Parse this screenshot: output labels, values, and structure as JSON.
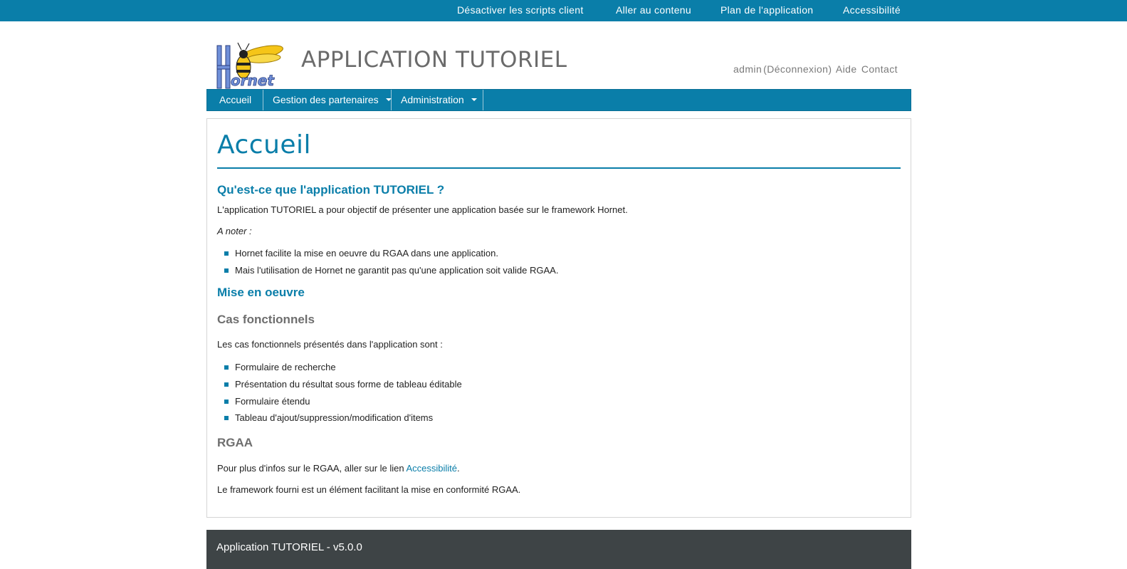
{
  "top_links": [
    "Désactiver les scripts client",
    "Aller au contenu",
    "Plan de l'application",
    "Accessibilité"
  ],
  "header": {
    "logo_text": "Hornet",
    "app_title": "APPLICATION TUTORIEL",
    "user": "admin",
    "logout": "(Déconnexion)",
    "help": "Aide",
    "contact": "Contact"
  },
  "nav": {
    "items": [
      {
        "label": "Accueil"
      },
      {
        "label": "Gestion des partenaires"
      },
      {
        "label": "Administration"
      }
    ]
  },
  "main": {
    "title": "Accueil",
    "section1": {
      "heading": "Qu'est-ce que l'application TUTORIEL ?",
      "intro": "L'application TUTORIEL a pour objectif de présenter une application basée sur le framework Hornet.",
      "note": "A noter :",
      "bullets": [
        "Hornet facilite la mise en oeuvre du RGAA dans une application.",
        "Mais l'utilisation de Hornet ne garantit pas qu'une application soit valide RGAA."
      ]
    },
    "section2": {
      "heading": "Mise en oeuvre",
      "sub1": {
        "heading": "Cas fonctionnels",
        "intro": "Les cas fonctionnels présentés dans l'application sont :",
        "bullets": [
          "Formulaire de recherche",
          "Présentation du résultat sous forme de tableau éditable",
          "Formulaire étendu",
          "Tableau d'ajout/suppression/modification d'items"
        ]
      },
      "sub2": {
        "heading": "RGAA",
        "p1_before": "Pour plus d'infos sur le RGAA, aller sur le lien ",
        "p1_link": "Accessibilité",
        "p1_after": ".",
        "p2": "Le framework fourni est un élément facilitant la mise en conformité RGAA."
      }
    }
  },
  "footer": {
    "text": "Application TUTORIEL - v5.0.0"
  },
  "colors": {
    "primary": "#0a7ea9",
    "footer_bg": "#3e4446",
    "muted_text": "#6e6e6e",
    "logo_wasp": "#f5c518",
    "logo_letters": "#6f8fd8"
  },
  "icons": {
    "logo": "hornet-wasp-logo",
    "dropdown": "caret-down-icon",
    "bullet": "square-bullet-icon"
  }
}
